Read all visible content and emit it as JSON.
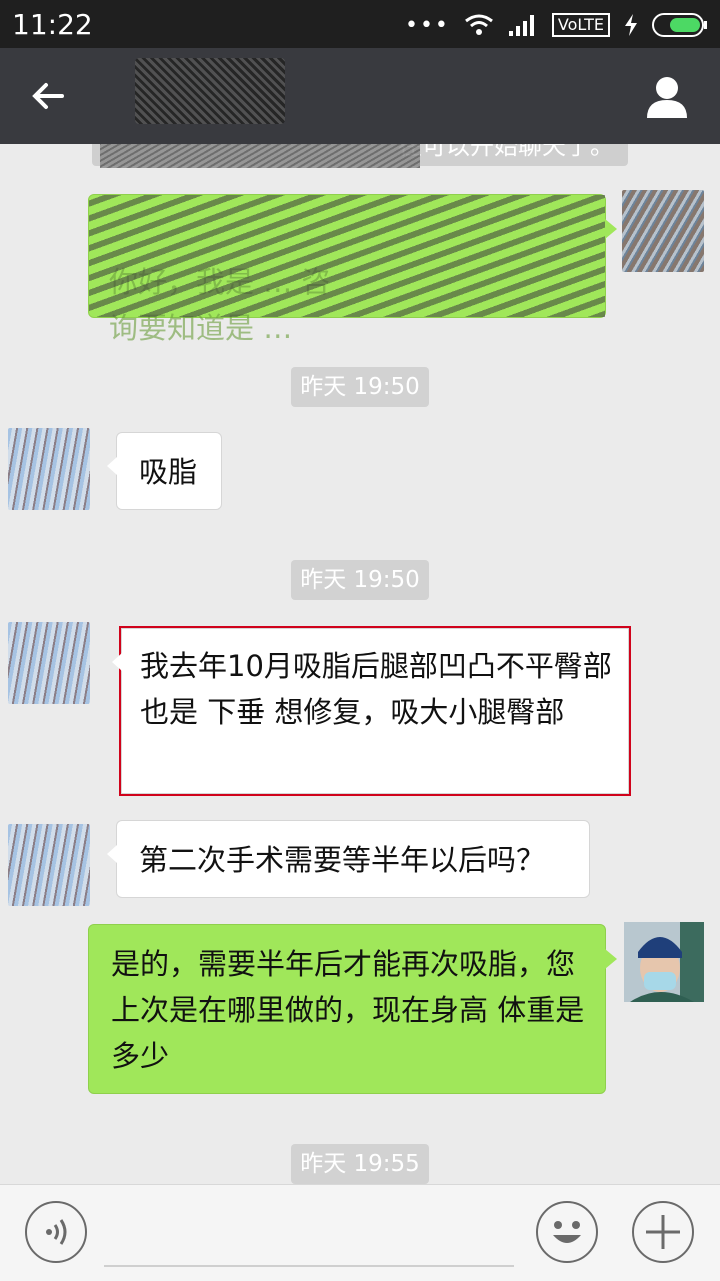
{
  "status_bar": {
    "time": "11:22",
    "dots": "•••",
    "network": "VoLTE",
    "battery_color": "#4cd964"
  },
  "header": {
    "back_icon": "arrow-left-icon",
    "profile_icon": "person-icon"
  },
  "chat": {
    "top_note": "在可以开始聊天了。",
    "first_out_message": {
      "visible_text": "你好，我是 … 咨\n询要知道是 …"
    },
    "timestamps": [
      "昨天 19:50",
      "昨天 19:50",
      "昨天 19:55"
    ],
    "messages": [
      {
        "side": "in",
        "text": "吸脂"
      },
      {
        "side": "in",
        "text": "我去年10月吸脂后腿部凹凸不平臀部也是 下垂 想修复，吸大小腿臀部",
        "highlighted": true
      },
      {
        "side": "in",
        "text": "第二次手术需要等半年以后吗？"
      },
      {
        "side": "out",
        "text": "是的，需要半年后才能再次吸脂，您上次是在哪里做的，现在身高 体重是多少"
      }
    ]
  },
  "input_bar": {
    "voice_icon": "voice-icon",
    "emoji_icon": "smiley-icon",
    "plus_icon": "plus-icon"
  },
  "colors": {
    "title_bar": "#393a3f",
    "bubble_out": "#a0e75a",
    "bubble_in": "#ffffff",
    "highlight": "#d0021b"
  }
}
